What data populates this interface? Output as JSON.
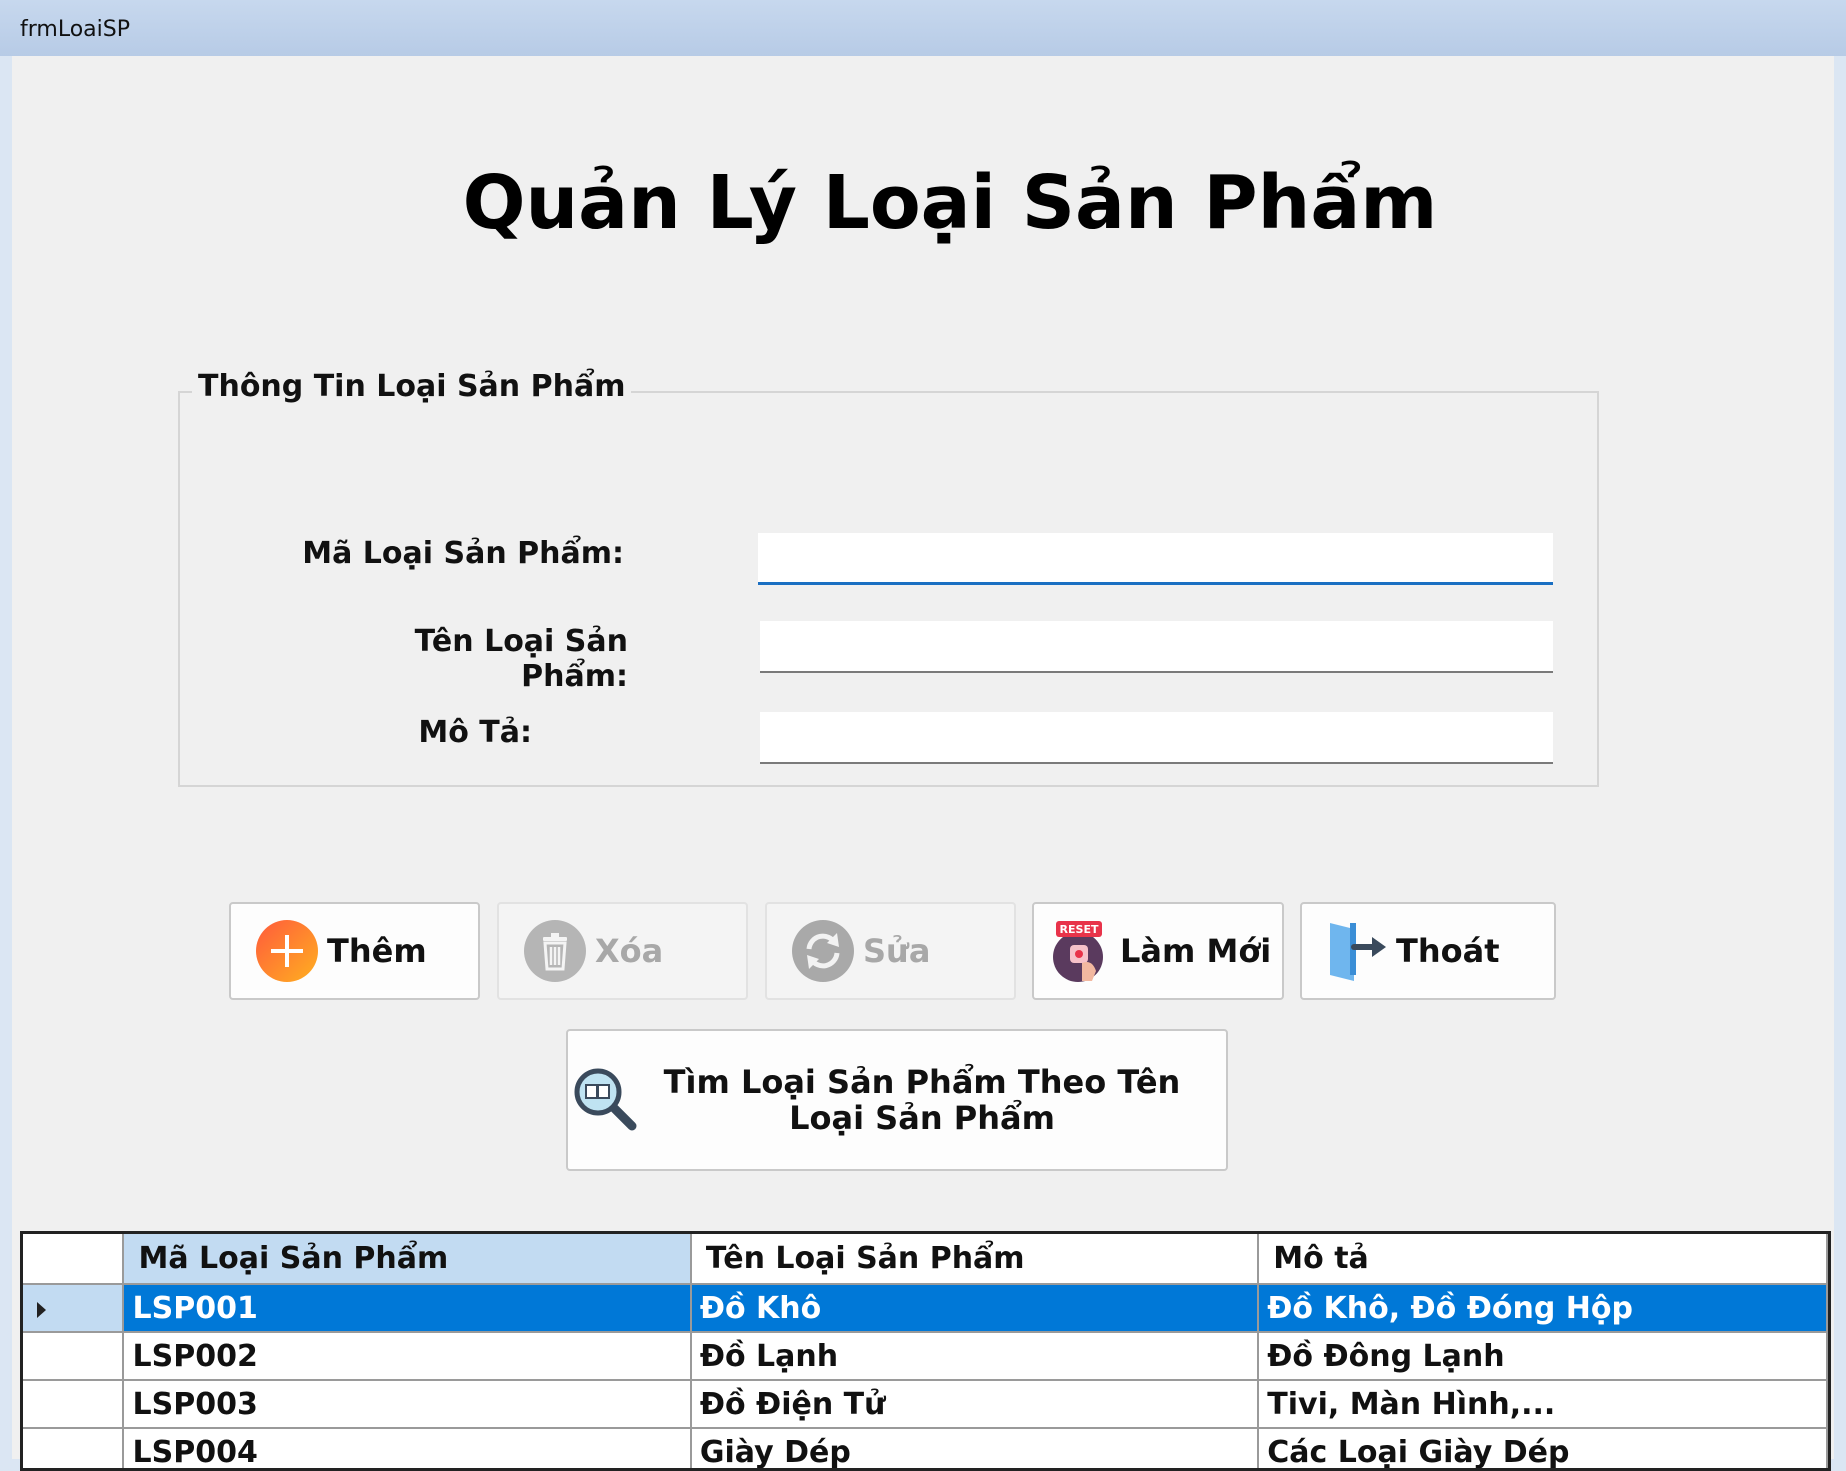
{
  "window": {
    "title": "frmLoaiSP"
  },
  "heading": "Quản Lý Loại Sản Phẩm",
  "group": {
    "title": "Thông Tin Loại Sản Phẩm",
    "fields": [
      {
        "label": "Mã Loại Sản Phẩm:",
        "value": ""
      },
      {
        "label": "Tên Loại Sản Phẩm:",
        "value": ""
      },
      {
        "label": "Mô Tả:",
        "value": ""
      }
    ]
  },
  "buttons": {
    "add": "Thêm",
    "delete": "Xóa",
    "edit": "Sửa",
    "refresh": "Làm Mới",
    "reset_badge": "RESET",
    "exit": "Thoát",
    "search": "Tìm Loại Sản Phẩm Theo Tên Loại Sản Phẩm"
  },
  "icons": {
    "add": "plus-circle-icon",
    "delete": "trash-icon",
    "edit": "sync-icon",
    "refresh": "reset-icon",
    "exit": "exit-door-icon",
    "search": "magnifier-book-icon"
  },
  "grid": {
    "columns": [
      "Mã Loại Sản Phẩm",
      "Tên Loại Sản Phẩm",
      "Mô tả"
    ],
    "rows": [
      [
        "LSP001",
        "Đồ Khô",
        "Đồ Khô, Đồ Đóng Hộp"
      ],
      [
        "LSP002",
        "Đồ Lạnh",
        "Đồ Đông Lạnh"
      ],
      [
        "LSP003",
        "Đồ Điện Tử",
        "Tivi, Màn Hình,..."
      ],
      [
        "LSP004",
        "Giày Dép",
        "Các Loại Giày Dép"
      ]
    ],
    "selected_row": 0
  },
  "colors": {
    "selection": "#0078d7",
    "header_selected": "#c2dbf2",
    "focus_underline": "#1a6fc2"
  }
}
